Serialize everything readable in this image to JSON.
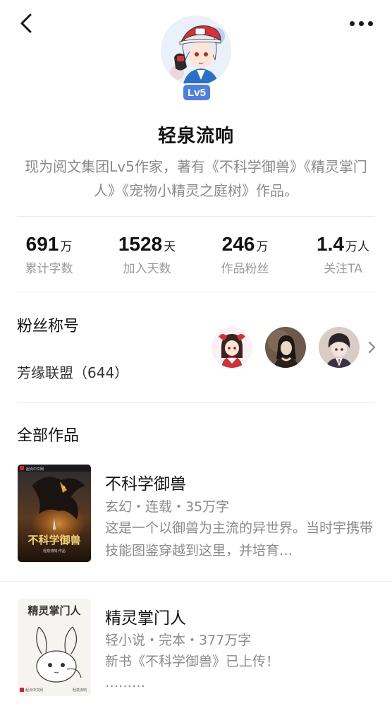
{
  "header": {
    "back_icon": "chevron-left-icon",
    "more_icon": "more-horizontal-icon"
  },
  "author": {
    "avatar": "anime-boy-red-cap-avatar",
    "level_badge": "Lv5",
    "name": "轻泉流响",
    "bio": "现为阅文集团Lv5作家，著有《不科学御兽》《精灵掌门人》《宠物小精灵之庭树》作品。",
    "accent_color": "#4f7fe6"
  },
  "stats": [
    {
      "value": "691",
      "unit": "万",
      "label": "累计字数"
    },
    {
      "value": "1528",
      "unit": "天",
      "label": "加入天数"
    },
    {
      "value": "246",
      "unit": "万",
      "label": "作品粉丝"
    },
    {
      "value": "1.4",
      "unit": "万人",
      "label": "关注TA"
    }
  ],
  "fans": {
    "section_title": "粉丝称号",
    "title_name": "芳缘联盟（644）",
    "avatars": [
      "shrine-maiden-avatar",
      "vintage-woman-avatar",
      "dark-haired-boy-avatar"
    ],
    "arrow_icon": "chevron-right-icon"
  },
  "works": {
    "section_title": "全部作品",
    "books": [
      {
        "title": "不科学御兽",
        "meta": "玄幻・连载・35万字",
        "description": "这是一个以御兽为主流的异世界。当时宇携带技能图鉴穿越到这里，并培育…",
        "cover_title": "不科学御兽",
        "cover_brand": "起点中文网",
        "cover_subtitle": "轻泉流响 作品"
      },
      {
        "title": "精灵掌门人",
        "meta": "轻小说・完本・377万字",
        "description": "新书《不科学御兽》已上传！\n………",
        "cover_title": "精灵掌门人",
        "cover_brand": "起点中文网",
        "cover_author": "轻泉流响"
      }
    ]
  }
}
